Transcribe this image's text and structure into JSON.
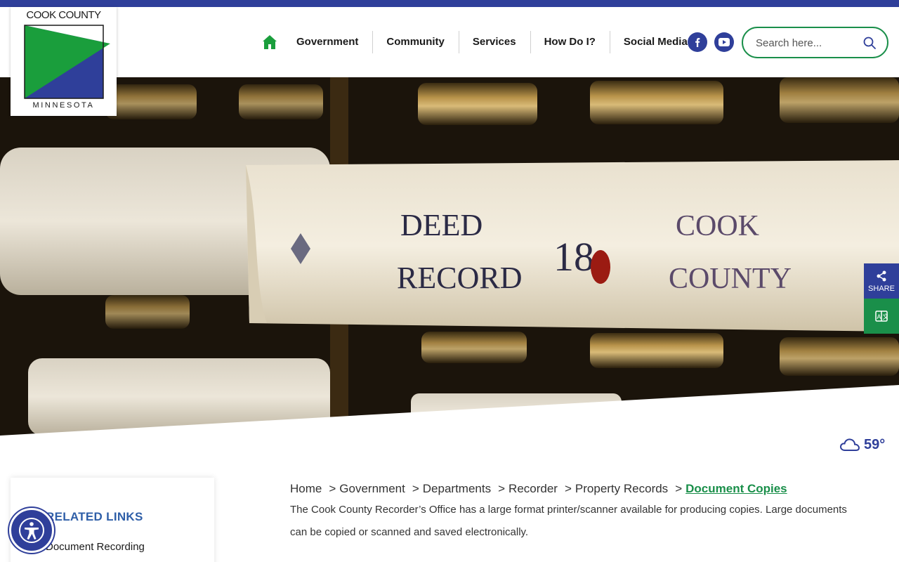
{
  "logo": {
    "top_text": "COOK COUNTY",
    "bottom_text": "MINNESOTA",
    "colors": {
      "green": "#1a9e3c",
      "blue": "#2f3f9a"
    }
  },
  "nav": {
    "home_icon": "home-icon",
    "items": [
      "Government",
      "Community",
      "Services",
      "How Do I?",
      "Social Media"
    ]
  },
  "social": {
    "facebook_icon": "facebook-icon",
    "youtube_icon": "youtube-icon"
  },
  "search": {
    "placeholder": "Search here...",
    "value": "",
    "icon": "search-icon"
  },
  "hero": {
    "book_spine_text": [
      "DEED",
      "RECORD",
      "18",
      "COOK",
      "COUNTY"
    ]
  },
  "floating": {
    "share_label": "SHARE",
    "share_icon": "share-icon",
    "translate_icon": "translate-icon"
  },
  "weather": {
    "icon": "cloud-icon",
    "temperature": "59°"
  },
  "sidebar": {
    "title": "RELATED LINKS",
    "links": [
      "Document Recording"
    ]
  },
  "breadcrumb": {
    "items": [
      "Home",
      "Government",
      "Departments",
      "Recorder",
      "Property Records"
    ],
    "current": "Document Copies"
  },
  "content": {
    "paragraph": "The Cook County Recorder’s Office has a large format printer/scanner available for producing copies. Large documents can be copied or scanned and saved electronically."
  },
  "accessibility": {
    "icon": "accessibility-icon"
  },
  "theme": {
    "primary_blue": "#2f3f9a",
    "primary_green": "#1a8f4a"
  }
}
